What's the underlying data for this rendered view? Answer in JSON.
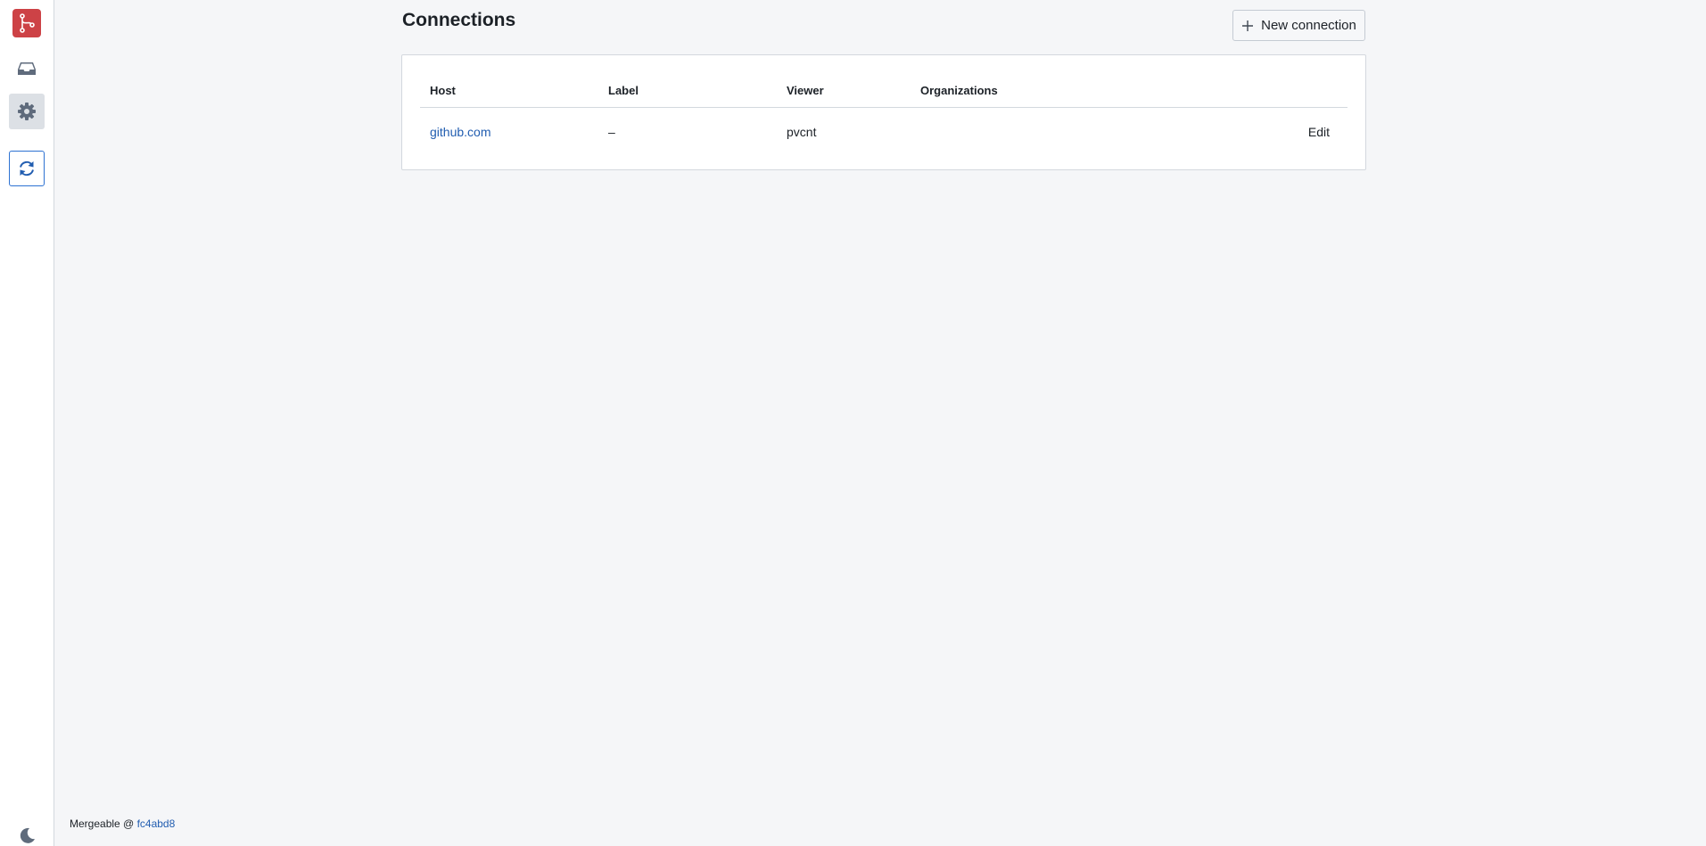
{
  "sidebar": {
    "items": [
      {
        "name": "inbox",
        "icon": "inbox-icon"
      },
      {
        "name": "settings",
        "icon": "gear-icon",
        "active": true
      },
      {
        "name": "sync",
        "icon": "refresh-icon"
      }
    ],
    "logo_icon": "git-branch-icon",
    "theme_icon": "moon-icon"
  },
  "main": {
    "title": "Connections",
    "new_button_label": "New connection",
    "table": {
      "headers": [
        "Host",
        "Label",
        "Viewer",
        "Organizations"
      ],
      "rows": [
        {
          "host": "github.com",
          "label": "–",
          "viewer": "pvcnt",
          "organizations": "",
          "action": "Edit"
        }
      ]
    }
  },
  "footer": {
    "app_name": "Mergeable @",
    "version": "fc4abd8"
  },
  "colors": {
    "brand": "#cd4246",
    "accent": "#2d72d2",
    "link": "#215db0",
    "background": "#f5f6f8"
  }
}
